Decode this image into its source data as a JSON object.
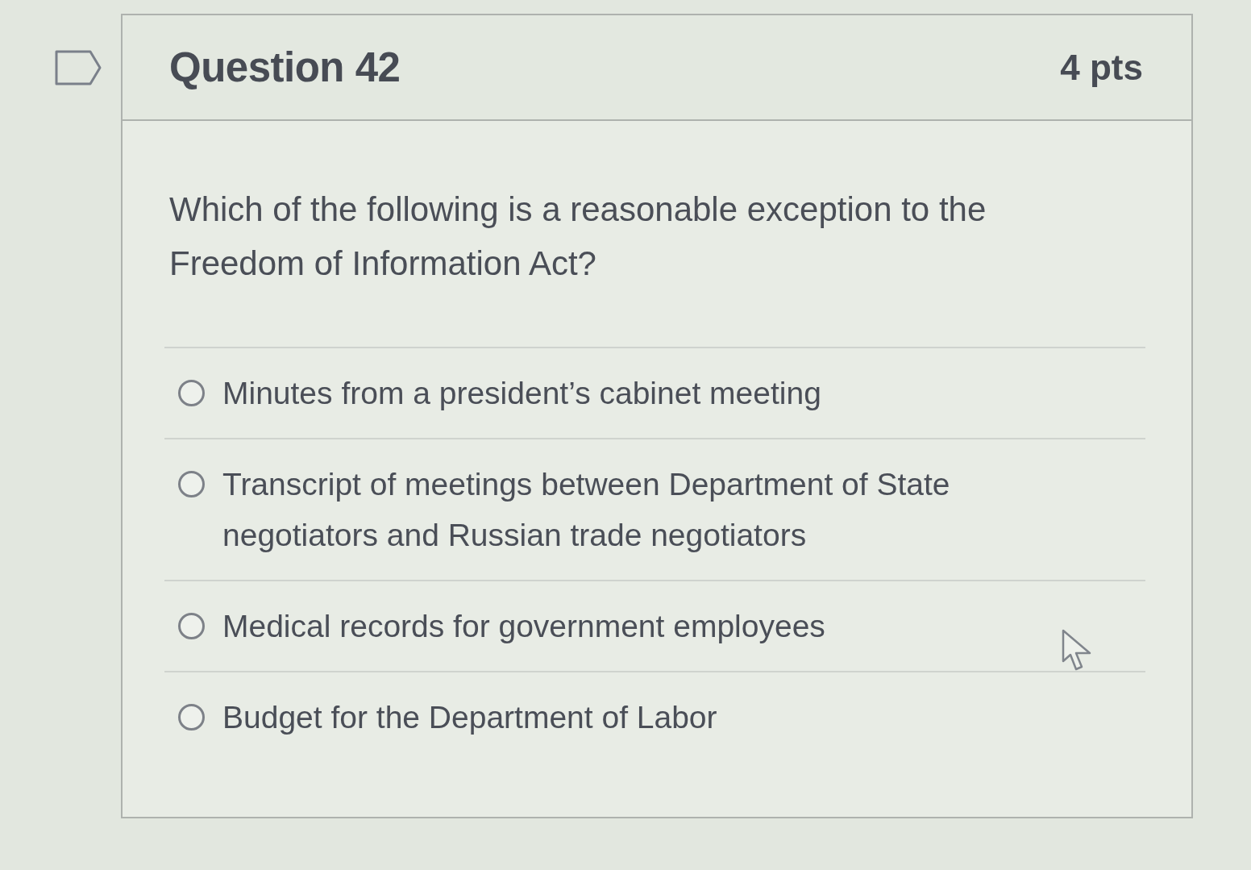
{
  "question": {
    "title": "Question 42",
    "points": "4 pts",
    "text": "Which of the following is a reasonable exception to the Freedom of Information Act?",
    "answers": [
      {
        "label": "Minutes from a president’s cabinet meeting",
        "selected": false
      },
      {
        "label": "Transcript of meetings between Department of State negotiators and Russian trade negotiators",
        "selected": false
      },
      {
        "label": "Medical records for government employees",
        "selected": false
      },
      {
        "label": "Budget for the Department of Labor",
        "selected": false
      }
    ]
  }
}
